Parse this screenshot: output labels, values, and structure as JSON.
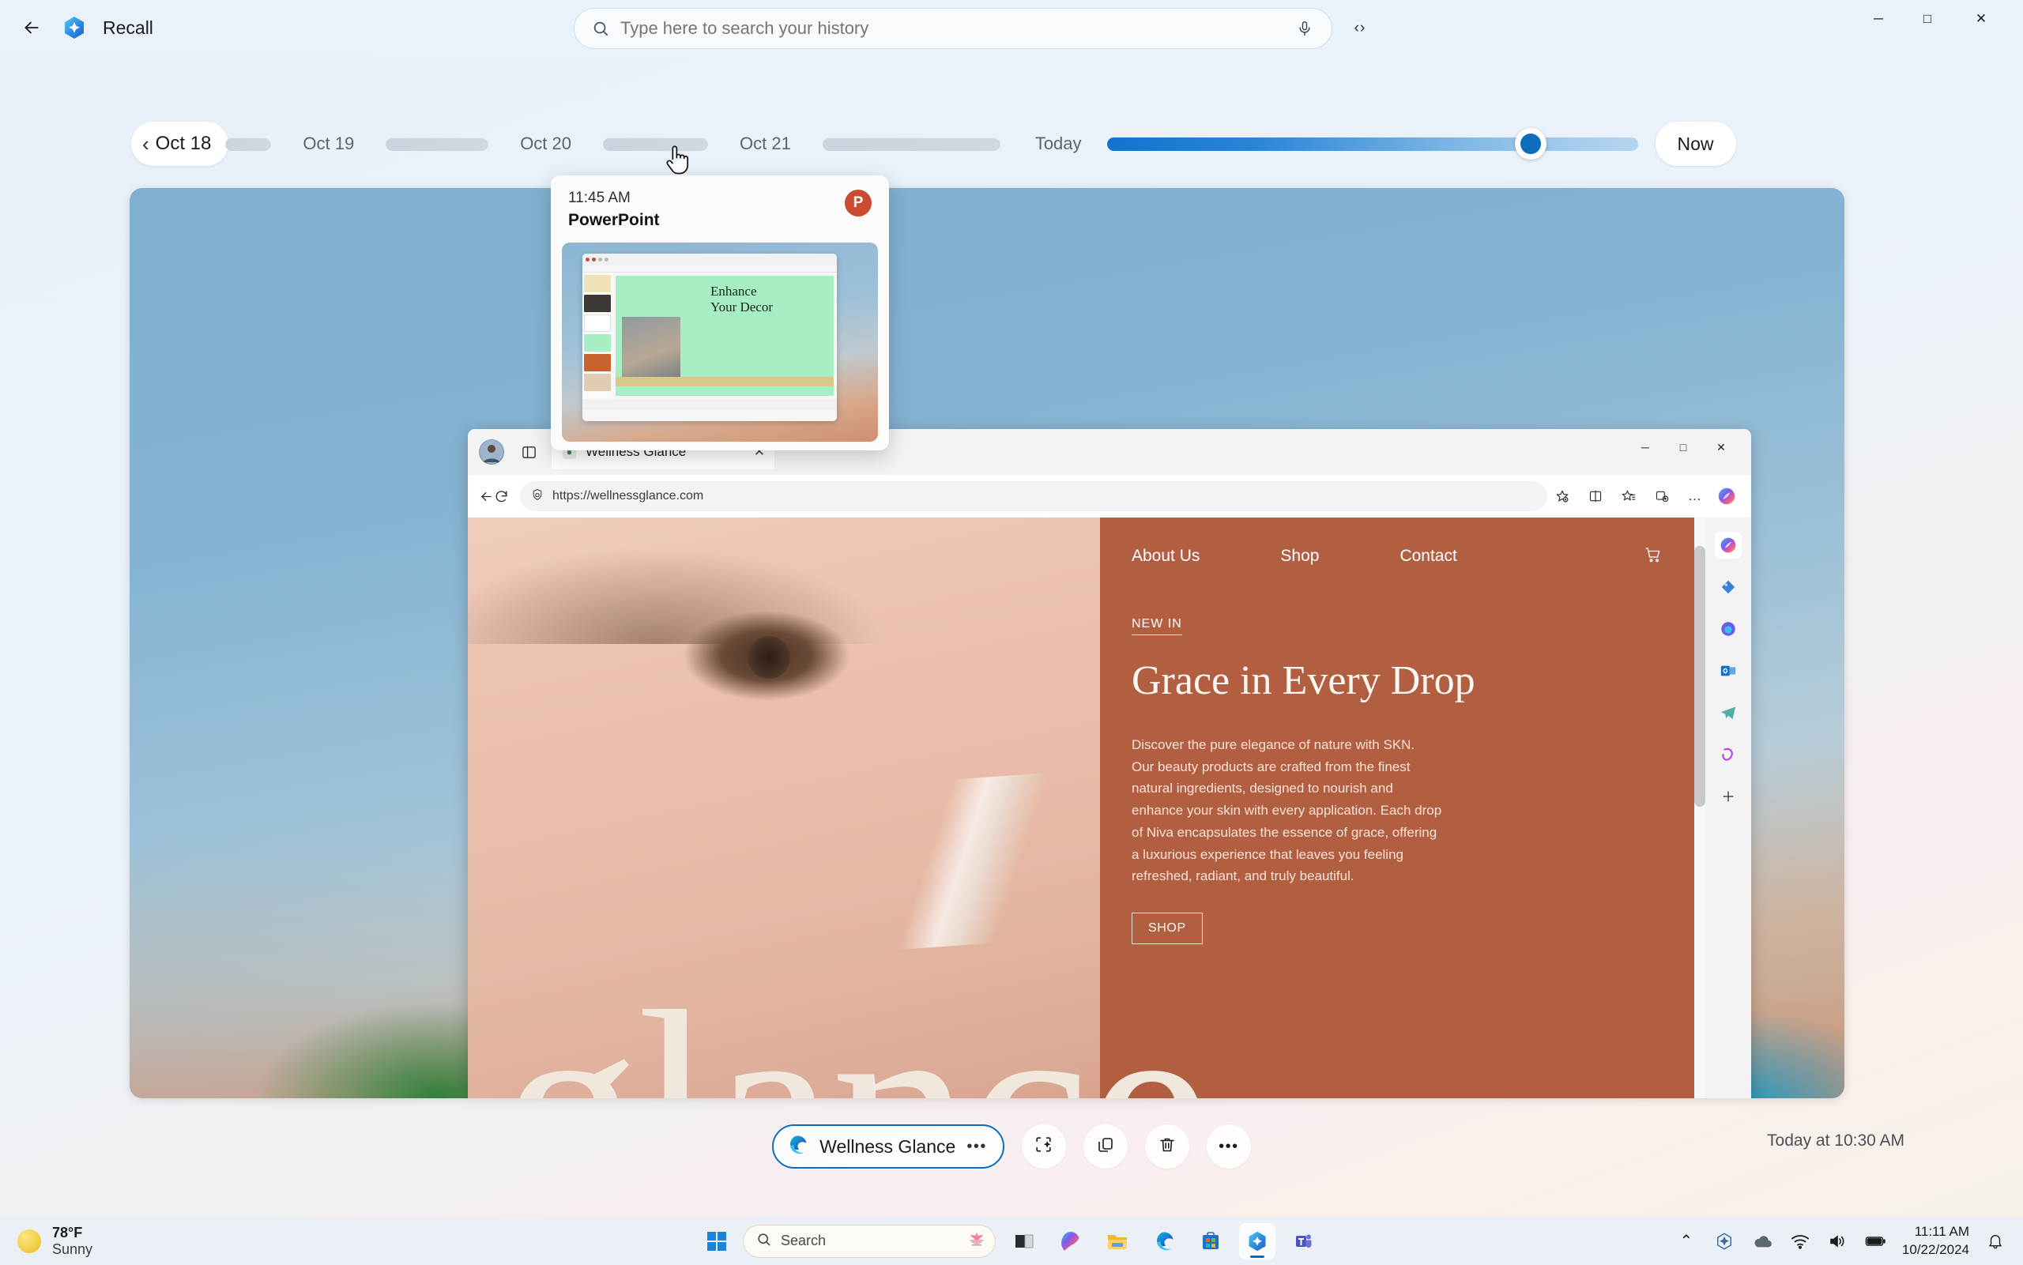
{
  "app": {
    "title": "Recall",
    "back_icon": "back-arrow-icon",
    "logo_icon": "recall-logo-icon"
  },
  "search": {
    "placeholder": "Type here to search your history",
    "value": "",
    "icon": "search-icon",
    "mic_icon": "microphone-icon",
    "more_icon": "more-options-icon",
    "more_label": "‹›"
  },
  "window_controls": {
    "minimize": "─",
    "maximize": "□",
    "close": "✕"
  },
  "timeline": {
    "current_day": "Oct 18",
    "back_chevron": "‹",
    "days": [
      "Oct 19",
      "Oct 20",
      "Oct 21"
    ],
    "today_label": "Today",
    "now_label": "Now",
    "slider_value_pct": 77
  },
  "preview_card": {
    "time": "11:45 AM",
    "app_name": "PowerPoint",
    "app_icon": "powerpoint-icon",
    "app_icon_letter": "P",
    "slide_title": "Enhance\nYour Decor"
  },
  "edge": {
    "tab": {
      "title": "Wellness Glance",
      "favicon": "wellness-glance-favicon",
      "close": "✕"
    },
    "url": "https://wellnessglance.com",
    "lock_icon": "shield-lock-icon",
    "back_icon": "browser-back-icon",
    "refresh_icon": "browser-refresh-icon",
    "toolbar_icons": [
      "add-to-collections-icon",
      "split-screen-icon",
      "favorites-icon",
      "collections-icon",
      "settings-more-icon"
    ],
    "more_label": "…",
    "sidebar_icons": [
      "copilot-icon",
      "shopping-tag-icon",
      "edge-drop-icon",
      "outlook-icon",
      "telegram-icon",
      "games-icon",
      "add-sidebar-icon"
    ],
    "sidebar_bottom_icons": [
      "sidebar-toggle-icon",
      "sidebar-settings-icon"
    ],
    "window_controls": {
      "minimize": "─",
      "maximize": "□",
      "close": "✕"
    }
  },
  "website": {
    "nav": [
      "About Us",
      "Shop",
      "Contact"
    ],
    "cart_icon": "shopping-cart-icon",
    "account_icon": "account-person-icon",
    "eyebrow": "NEW IN",
    "headline": "Grace in Every Drop",
    "paragraph": "Discover the pure elegance of nature with SKN.\nOur beauty products are crafted from the finest natural ingredients, designed to nourish and enhance your skin with every application. Each drop of Niva encapsulates the essence of grace, offering a luxurious experience that leaves you feeling refreshed, radiant, and truly beautiful.",
    "cta": "SHOP",
    "hero_word": "glance",
    "accent_color": "#b25f41"
  },
  "action_bar": {
    "app_chip_label": "Wellness Glance",
    "app_chip_icon": "edge-icon",
    "app_chip_dots": "•••",
    "buttons": [
      {
        "name": "click-to-do-button",
        "icon": "click-to-do-icon"
      },
      {
        "name": "copy-button",
        "icon": "copy-icon"
      },
      {
        "name": "delete-button",
        "icon": "trash-icon"
      },
      {
        "name": "more-button",
        "icon": "more-dots-icon",
        "label": "•••"
      }
    ],
    "capture_time": "Today at 10:30 AM"
  },
  "taskbar": {
    "weather": {
      "temperature": "78°F",
      "condition": "Sunny",
      "icon": "sun-icon"
    },
    "start_icon": "windows-start-icon",
    "search_placeholder": "Search",
    "search_icon": "search-icon",
    "search_badge_icon": "lotus-icon",
    "apps": [
      {
        "name": "taskview-icon",
        "label": "Task View"
      },
      {
        "name": "copilot-icon",
        "label": "Copilot"
      },
      {
        "name": "file-explorer-icon",
        "label": "File Explorer"
      },
      {
        "name": "edge-icon",
        "label": "Microsoft Edge"
      },
      {
        "name": "microsoft-store-icon",
        "label": "Microsoft Store"
      },
      {
        "name": "recall-icon",
        "label": "Recall"
      },
      {
        "name": "teams-icon",
        "label": "Microsoft Teams"
      }
    ],
    "tray": {
      "chevron": "⌃",
      "icons": [
        "recall-tray-icon",
        "onedrive-icon",
        "wifi-icon",
        "volume-icon",
        "battery-icon"
      ],
      "time": "11:11 AM",
      "date": "10/22/2024",
      "notification_icon": "bell-icon"
    }
  },
  "colors": {
    "accent": "#0f6cbd",
    "site_accent": "#b25f41",
    "taskbar_bg": "#eaf0f6"
  }
}
